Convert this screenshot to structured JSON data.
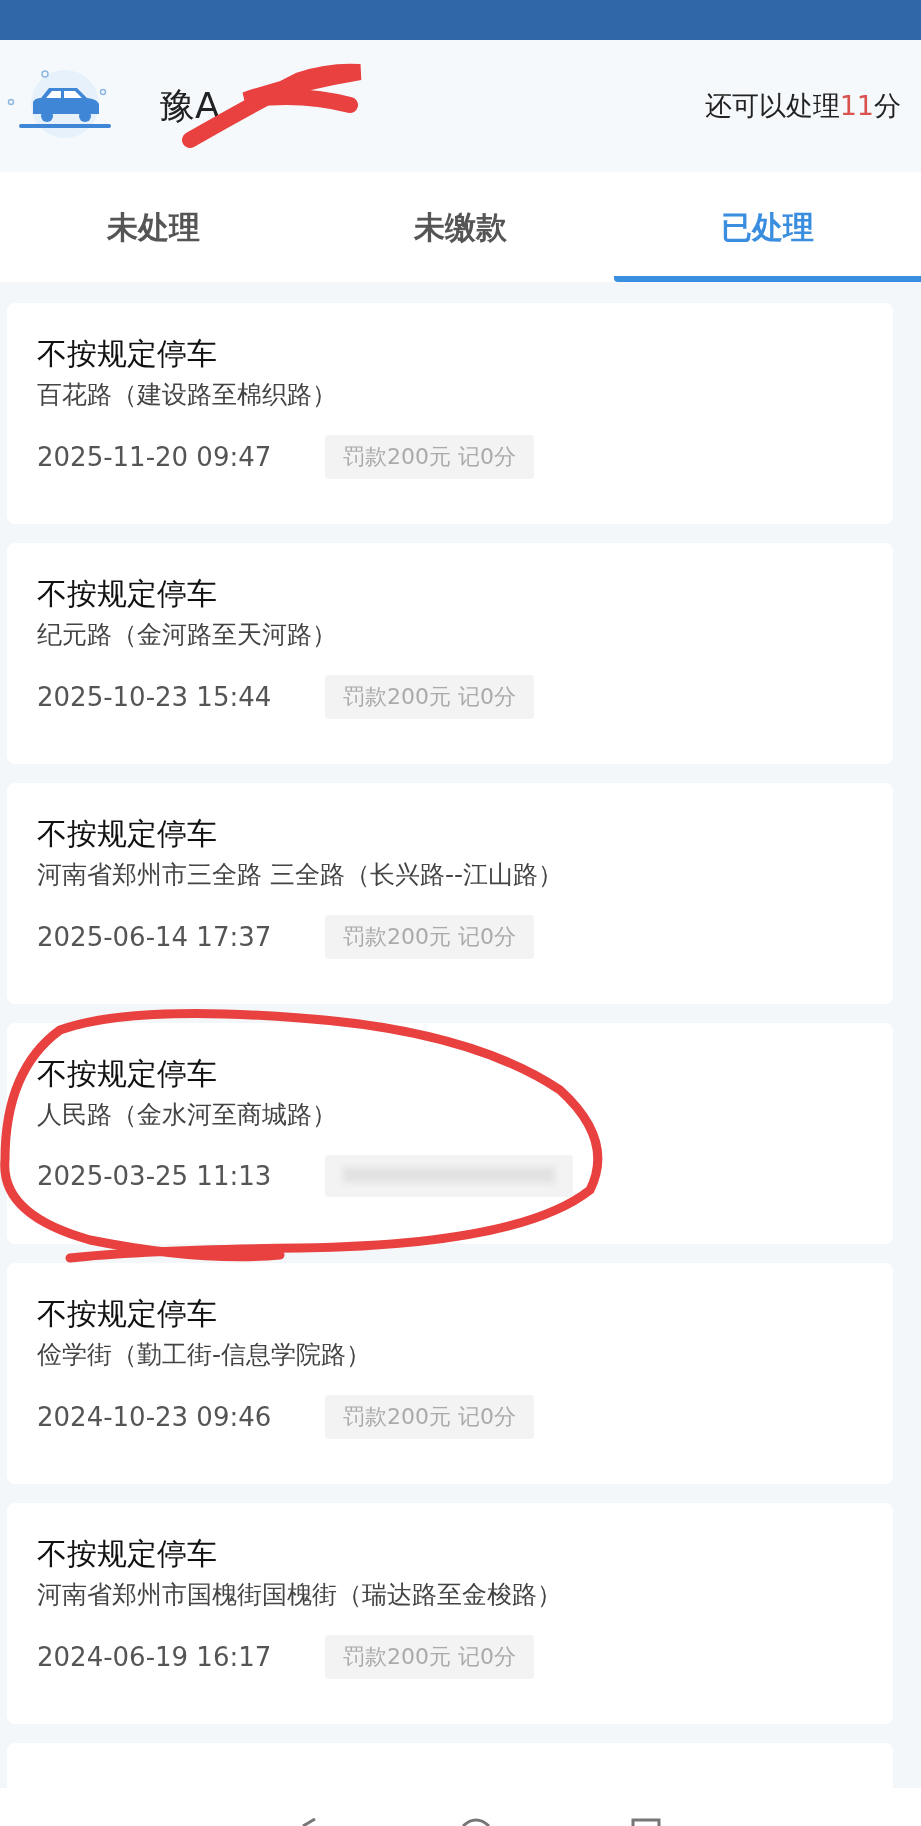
{
  "vehicle": {
    "plate": "豫A",
    "points_prefix": "还可以处理",
    "points": "11",
    "points_suffix": "分"
  },
  "tabs": [
    {
      "label": "未处理",
      "selected": false
    },
    {
      "label": "未缴款",
      "selected": false
    },
    {
      "label": "已处理",
      "selected": true
    }
  ],
  "records": [
    {
      "title": "不按规定停车",
      "place": "百花路（建设路至棉织路）",
      "time": "2025-11-20 09:47",
      "penalty": "罚款200元 记0分",
      "penalty_blurred": false
    },
    {
      "title": "不按规定停车",
      "place": "纪元路（金河路至天河路）",
      "time": "2025-10-23 15:44",
      "penalty": "罚款200元 记0分",
      "penalty_blurred": false
    },
    {
      "title": "不按规定停车",
      "place": "河南省郑州市三全路 三全路（长兴路--江山路）",
      "time": "2025-06-14 17:37",
      "penalty": "罚款200元 记0分",
      "penalty_blurred": false
    },
    {
      "title": "不按规定停车",
      "place": "人民路（金水河至商城路）",
      "time": "2025-03-25 11:13",
      "penalty_blurred": true
    },
    {
      "title": "不按规定停车",
      "place": "俭学街（勤工街-信息学院路）",
      "time": "2024-10-23 09:46",
      "penalty": "罚款200元 记0分",
      "penalty_blurred": false
    },
    {
      "title": "不按规定停车",
      "place": "河南省郑州市国槐街国槐街（瑞达路至金梭路）",
      "time": "2024-06-19 16:17",
      "penalty": "罚款200元 记0分",
      "penalty_blurred": false
    }
  ]
}
